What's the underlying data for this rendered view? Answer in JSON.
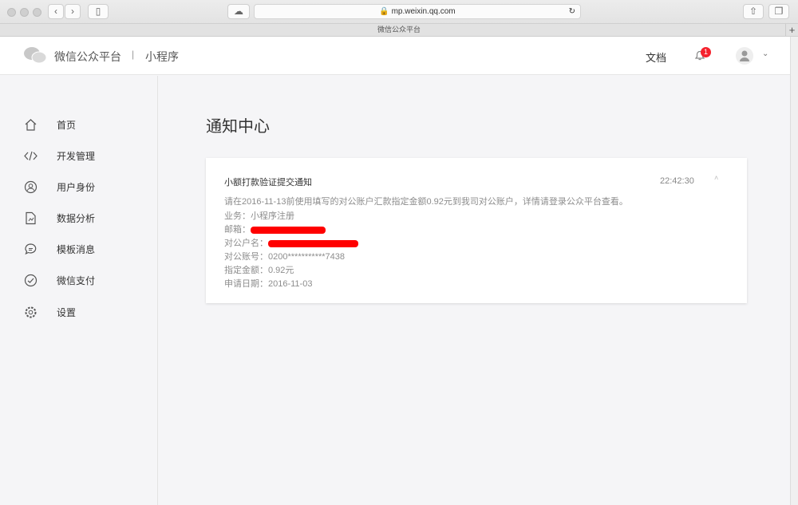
{
  "browser": {
    "url": "mp.weixin.qq.com",
    "tab_title": "微信公众平台"
  },
  "header": {
    "brand": "微信公众平台",
    "separator": "|",
    "product": "小程序",
    "docs": "文档",
    "notification_count": "1"
  },
  "sidebar": {
    "items": [
      {
        "label": "首页",
        "icon": "home-icon"
      },
      {
        "label": "开发管理",
        "icon": "code-icon"
      },
      {
        "label": "用户身份",
        "icon": "user-icon"
      },
      {
        "label": "数据分析",
        "icon": "chart-file-icon"
      },
      {
        "label": "模板消息",
        "icon": "message-icon"
      },
      {
        "label": "微信支付",
        "icon": "pay-icon"
      },
      {
        "label": "设置",
        "icon": "gear-icon"
      }
    ]
  },
  "main": {
    "title": "通知中心",
    "notification": {
      "title": "小额打款验证提交通知",
      "time": "22:42:30",
      "body": "请在2016-11-13前使用填写的对公账户汇款指定金额0.92元到我司对公账户，详情请登录公众平台查看。",
      "business_label": "业务：",
      "business": "小程序注册",
      "email_label": "邮箱：",
      "account_name_label": "对公户名：",
      "account_no_label": "对公账号：",
      "account_no": "0200***********7438",
      "amount_label": "指定金额：",
      "amount": "0.92元",
      "date_label": "申请日期：",
      "date": "2016-11-03"
    }
  },
  "colors": {
    "badge": "#f5222d",
    "redaction": "#ff0000"
  }
}
